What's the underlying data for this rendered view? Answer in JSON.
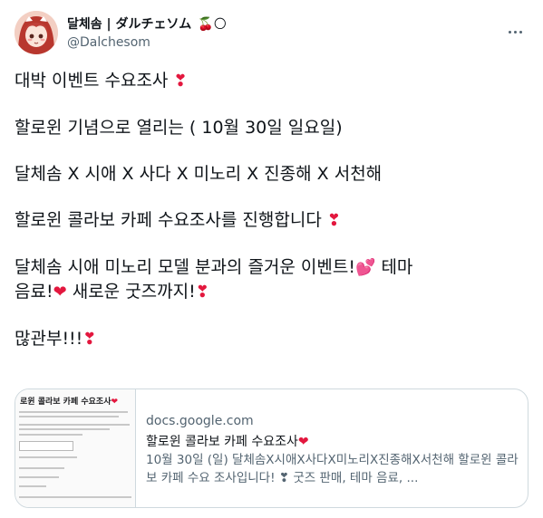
{
  "author": {
    "display_name": "달체솜 | ダルチェソム",
    "name_emoji": "🍒🌕",
    "handle": "@Dalchesom"
  },
  "tweet": {
    "lines": [
      "대박 이벤트 수요조사",
      "할로윈 기념으로 열리는 ( 10월 30일 일요일)",
      "달체솜 X 시애 X 사다 X 미노리 X 진종해 X 서천해",
      "할로윈 콜라보 카페 수요조사를 진행합니다",
      "달체솜 시애 미노리 모델 분과의 즐거운 이벤트!",
      "테마",
      "음료!",
      "새로운 굿즈까지!",
      "많관부!!!"
    ]
  },
  "link_card": {
    "domain": "docs.google.com",
    "title": "할로윈 콜라보 카페 수요조사",
    "description": "10월 30일 (일) 달체솜X시애X사다X미노리X진종해X서천해 할로윈 콜라보 카페 수요 조사입니다! ❣ 굿즈 판매, 테마 음료, ...",
    "thumbnail_title": "로윈 콜라보 카페 수요조사"
  },
  "icons": {
    "heart_exclamation": "❣",
    "two_hearts": "💕",
    "heart": "❤",
    "more": "more-icon"
  },
  "colors": {
    "heart": "#e3173e",
    "secondary_text": "#536471",
    "border": "#cfd9de"
  }
}
